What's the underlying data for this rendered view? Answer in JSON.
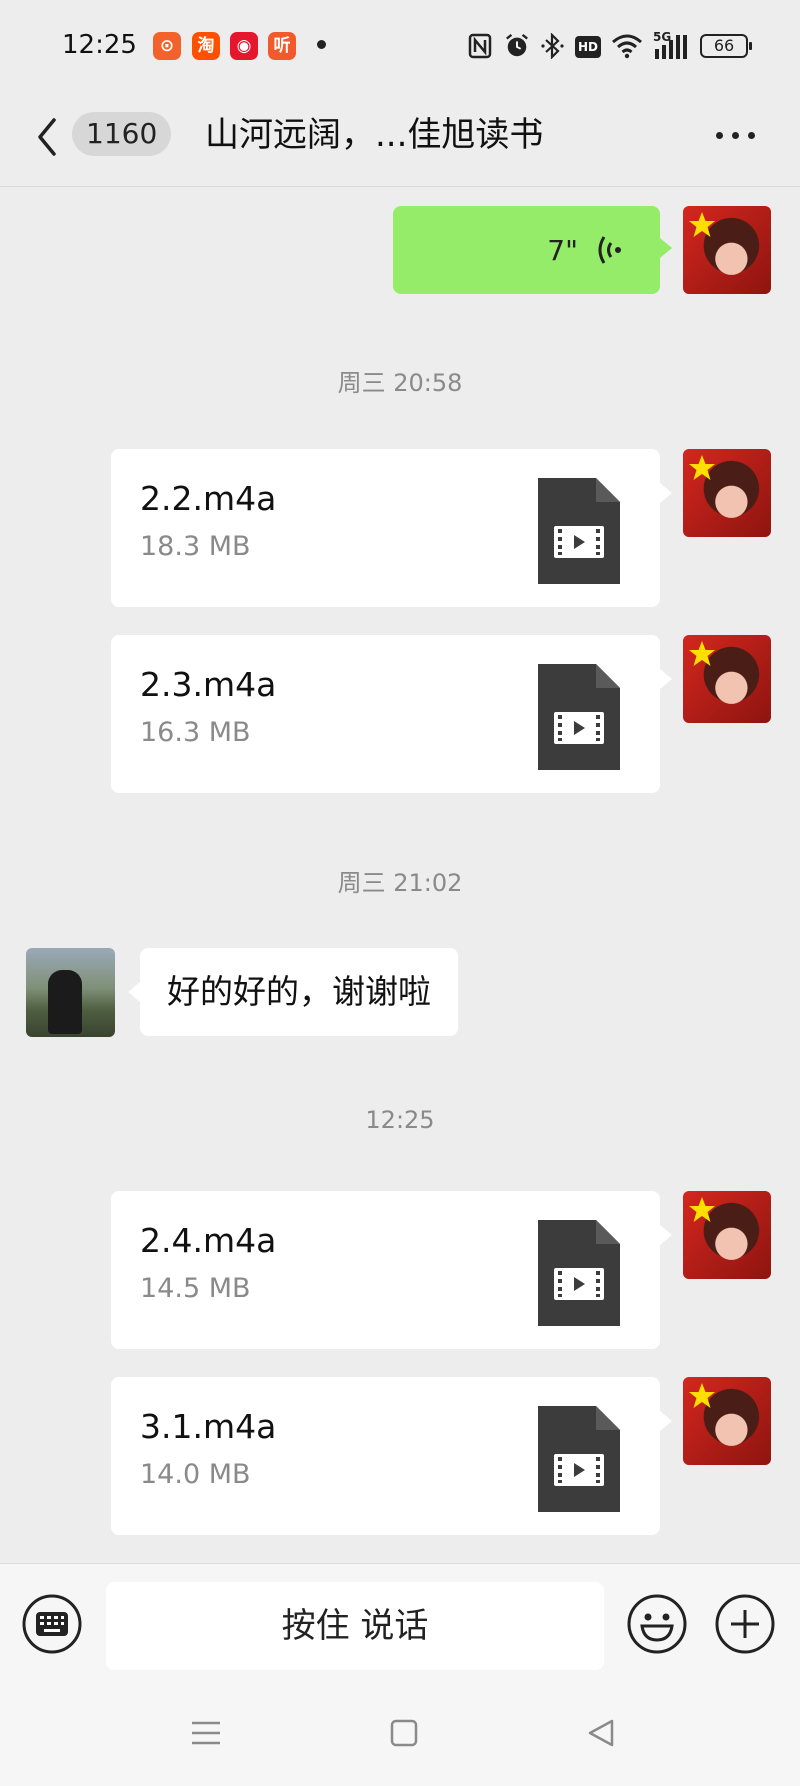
{
  "status_bar": {
    "time": "12:25",
    "battery": "66",
    "app_icons": [
      {
        "name": "kuaishou-icon",
        "glyph": "⊙",
        "color": "#f2622a"
      },
      {
        "name": "taobao-icon",
        "glyph": "淘",
        "color": "#ff5000"
      },
      {
        "name": "weibo-icon",
        "glyph": "◉",
        "color": "#e6162d"
      },
      {
        "name": "ting-icon",
        "glyph": "听",
        "color": "#f35a2b"
      }
    ],
    "network_label": "5G",
    "hd_label": "HD"
  },
  "header": {
    "unread_count": "1160",
    "title": "山河远阔，...佳旭读书"
  },
  "messages": {
    "voice": {
      "duration": "7\""
    },
    "timestamps": [
      "周三 20:58",
      "周三 21:02",
      "12:25"
    ],
    "files": [
      {
        "name": "2.2.m4a",
        "size": "18.3 MB"
      },
      {
        "name": "2.3.m4a",
        "size": "16.3 MB"
      },
      {
        "name": "2.4.m4a",
        "size": "14.5 MB"
      },
      {
        "name": "3.1.m4a",
        "size": "14.0 MB"
      }
    ],
    "reply_text": "好的好的，谢谢啦"
  },
  "input_bar": {
    "hold_to_talk": "按住 说话"
  },
  "colors": {
    "voice_bubble": "#95ec69",
    "background": "#ededed",
    "file_icon": "#3c3c3c"
  }
}
